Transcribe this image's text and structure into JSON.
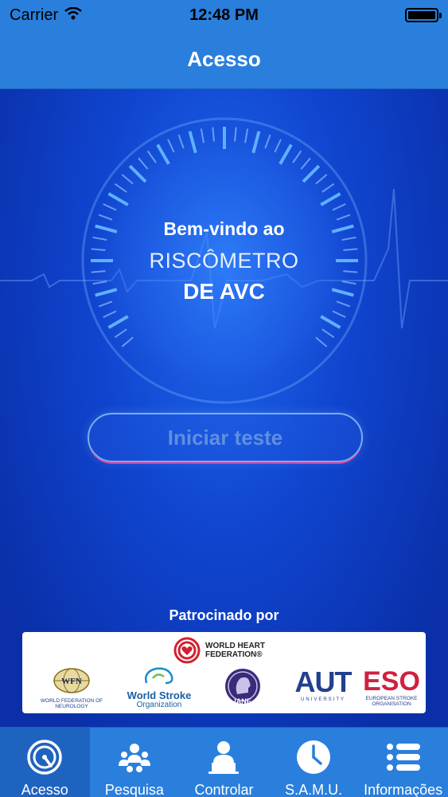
{
  "status_bar": {
    "carrier": "Carrier",
    "time": "12:48 PM"
  },
  "nav": {
    "title": "Acesso"
  },
  "welcome": {
    "line1": "Bem-vindo ao",
    "line2": "RISCÔMETRO",
    "line3": "DE AVC"
  },
  "start_button": {
    "label": "Iniciar teste"
  },
  "sponsors": {
    "label": "Patrocinado por",
    "whf": "WORLD HEART FEDERATION®",
    "wfn_mark": "WFN",
    "wfn": "WORLD FEDERATION OF NEUROLOGY",
    "wso_title": "World Stroke",
    "wso_sub": "Organization",
    "iane": "IANE",
    "aut": "AUT",
    "aut_sub": "UNIVERSITY",
    "eso": "ESO",
    "eso_sub": "EUROPEAN STROKE ORGANISATION"
  },
  "tabs": [
    {
      "label": "Acesso",
      "icon": "gauge-icon",
      "active": true
    },
    {
      "label": "Pesquisa",
      "icon": "people-icon",
      "active": false
    },
    {
      "label": "Controlar",
      "icon": "user-laptop-icon",
      "active": false
    },
    {
      "label": "S.A.M.U.",
      "icon": "clock-icon",
      "active": false
    },
    {
      "label": "Informações",
      "icon": "list-icon",
      "active": false
    }
  ],
  "colors": {
    "bar": "#2a7fdc",
    "background": "#0a2fa8",
    "accent_pink": "#e0409a"
  }
}
